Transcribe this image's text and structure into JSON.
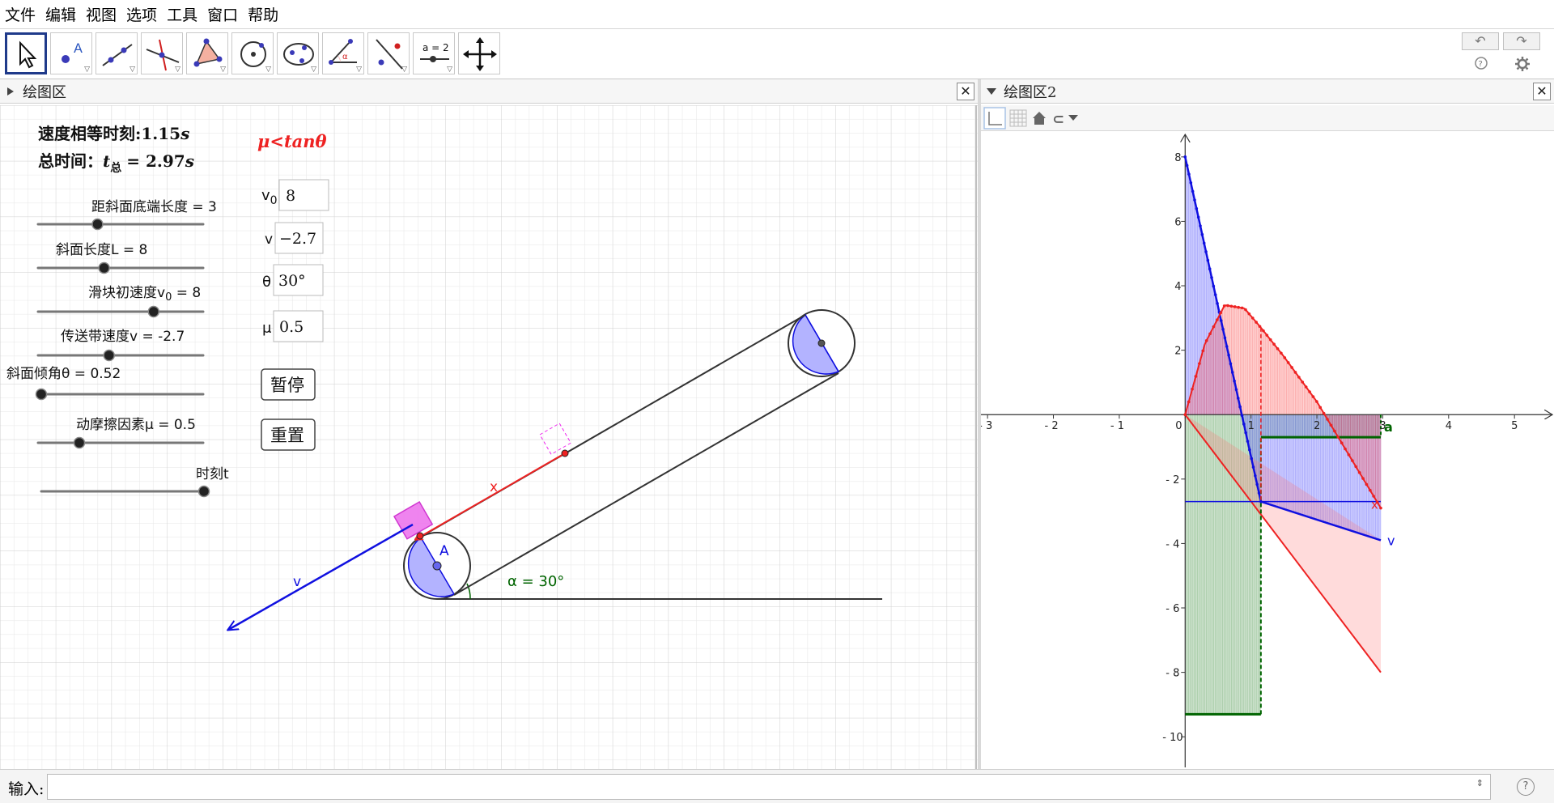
{
  "menu": [
    "文件",
    "编辑",
    "视图",
    "选项",
    "工具",
    "窗口",
    "帮助"
  ],
  "toolbar": {
    "tools": [
      "move",
      "point",
      "line",
      "perpendicular",
      "polygon",
      "circle",
      "conic",
      "angle",
      "reflect",
      "slider",
      "move-graphics"
    ],
    "slider_tool_label": "a = 2",
    "point_tool_label": "A"
  },
  "panel1": {
    "title": "绘图区"
  },
  "panel2": {
    "title": "绘图区2"
  },
  "text": {
    "equal_speed_label": "速度相等时刻:",
    "equal_speed_value": "1.15",
    "equal_speed_unit": "s",
    "total_time_label": "总时间：",
    "total_time_var": "t",
    "total_time_sub": "总",
    "total_time_value": "= 2.97",
    "total_time_unit": "s",
    "condition": "μ<tanθ"
  },
  "sliders": [
    {
      "label": "距斜面底端长度 = 3",
      "fraction": 0.36
    },
    {
      "label": "斜面长度L = 8",
      "fraction": 0.4
    },
    {
      "label": "滑块初速度v",
      "sub": "0",
      "suffix": " = 8",
      "fraction": 0.7
    },
    {
      "label": "传送带速度v = -2.7",
      "fraction": 0.43
    },
    {
      "label": "斜面倾角θ = 0.52",
      "fraction": 0.0
    },
    {
      "label": "动摩擦因素μ = 0.5",
      "fraction": 0.25
    },
    {
      "label": "时刻t",
      "fraction": 1.0
    }
  ],
  "inputs": [
    {
      "label": "v",
      "sub": "0",
      "value": "8"
    },
    {
      "label": "v",
      "sub": "",
      "value": "−2.7"
    },
    {
      "label": "θ",
      "sub": "",
      "value": "30°"
    },
    {
      "label": "μ",
      "sub": "",
      "value": "0.5"
    }
  ],
  "buttons": {
    "pause": "暂停",
    "reset": "重置"
  },
  "labels": {
    "x": "x",
    "v": "v",
    "A": "A",
    "alpha": "α = 30°",
    "graph_v": "v",
    "graph_a": "a",
    "graph_x": "x"
  },
  "graph2": {
    "x_ticks": [
      "- 3",
      "- 2",
      "- 1",
      "0",
      "1",
      "2",
      "3",
      "4",
      "5"
    ],
    "y_ticks": [
      "8",
      "6",
      "4",
      "2",
      "- 2",
      "- 4",
      "- 6",
      "- 8",
      "- 10"
    ]
  },
  "chart_data": {
    "type": "line",
    "series": [
      {
        "name": "v",
        "x": [
          0,
          1.15,
          2.97
        ],
        "y": [
          8,
          -2.7,
          -3.9
        ]
      },
      {
        "name": "x",
        "x": [
          0,
          0.3,
          0.6,
          0.9,
          1.15,
          1.5,
          2.0,
          2.5,
          2.97
        ],
        "y": [
          0,
          2.2,
          3.4,
          3.3,
          2.7,
          1.8,
          0.4,
          -1.3,
          -2.9
        ]
      },
      {
        "name": "a",
        "x": [
          0,
          1.15,
          1.15,
          2.97
        ],
        "y": [
          -9.3,
          -9.3,
          -0.7,
          -0.7
        ]
      }
    ],
    "xlim": [
      -3.1,
      5.6
    ],
    "ylim": [
      -11,
      8.8
    ],
    "grid": false
  },
  "input_bar": {
    "label": "输入:",
    "help": "?"
  },
  "colors": {
    "blue": "#1010e0",
    "red": "#ee2222",
    "green": "#006400",
    "magenta": "#ee22ee"
  }
}
